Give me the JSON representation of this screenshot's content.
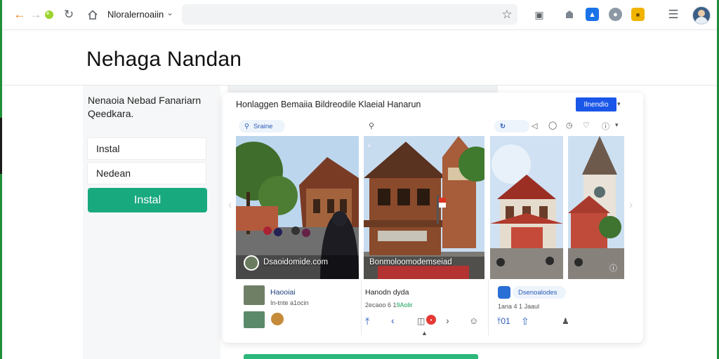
{
  "toolbar": {
    "site_label": "Nloralernoaiin",
    "icons": [
      "back-icon",
      "forward-icon",
      "reload-icon",
      "home-icon",
      "star-icon",
      "cast-icon",
      "puzzle-icon",
      "extension-blue-icon",
      "extension-gray-icon",
      "extension-orange-icon",
      "reading-list-icon",
      "profile-avatar"
    ]
  },
  "page": {
    "title": "Nehaga Nandan",
    "left_description": "Nenaoia Nebad Fanariarn Qeedkara.",
    "field1": "Instal",
    "field2": "Nedean",
    "install_button": "Instal"
  },
  "card": {
    "title": "Honlaggen Bemaiia Bildreodile Klaeial Hanarun",
    "button_label": "Ilnendio",
    "pill_left": "Sraine",
    "panel1": {
      "overlay": "Dsaoidomide.com",
      "name": "Haooiai",
      "sub": "In-tnte a1ocin"
    },
    "panel2": {
      "overlay": "Bonmoloomodemseiad",
      "name": "Hanodn dyda",
      "sub_prefix": "2ecaoo 6 1",
      "sub_green": "9Aolir",
      "badge": "•"
    },
    "panel3": {
      "name": "Dsenoalodes",
      "sub": "1ana 4 1 Jaaul",
      "action_text": "01"
    }
  },
  "colors": {
    "accent_green": "#19a97f",
    "accent_blue": "#1a56e8",
    "edge_green": "#1f8f3a"
  }
}
